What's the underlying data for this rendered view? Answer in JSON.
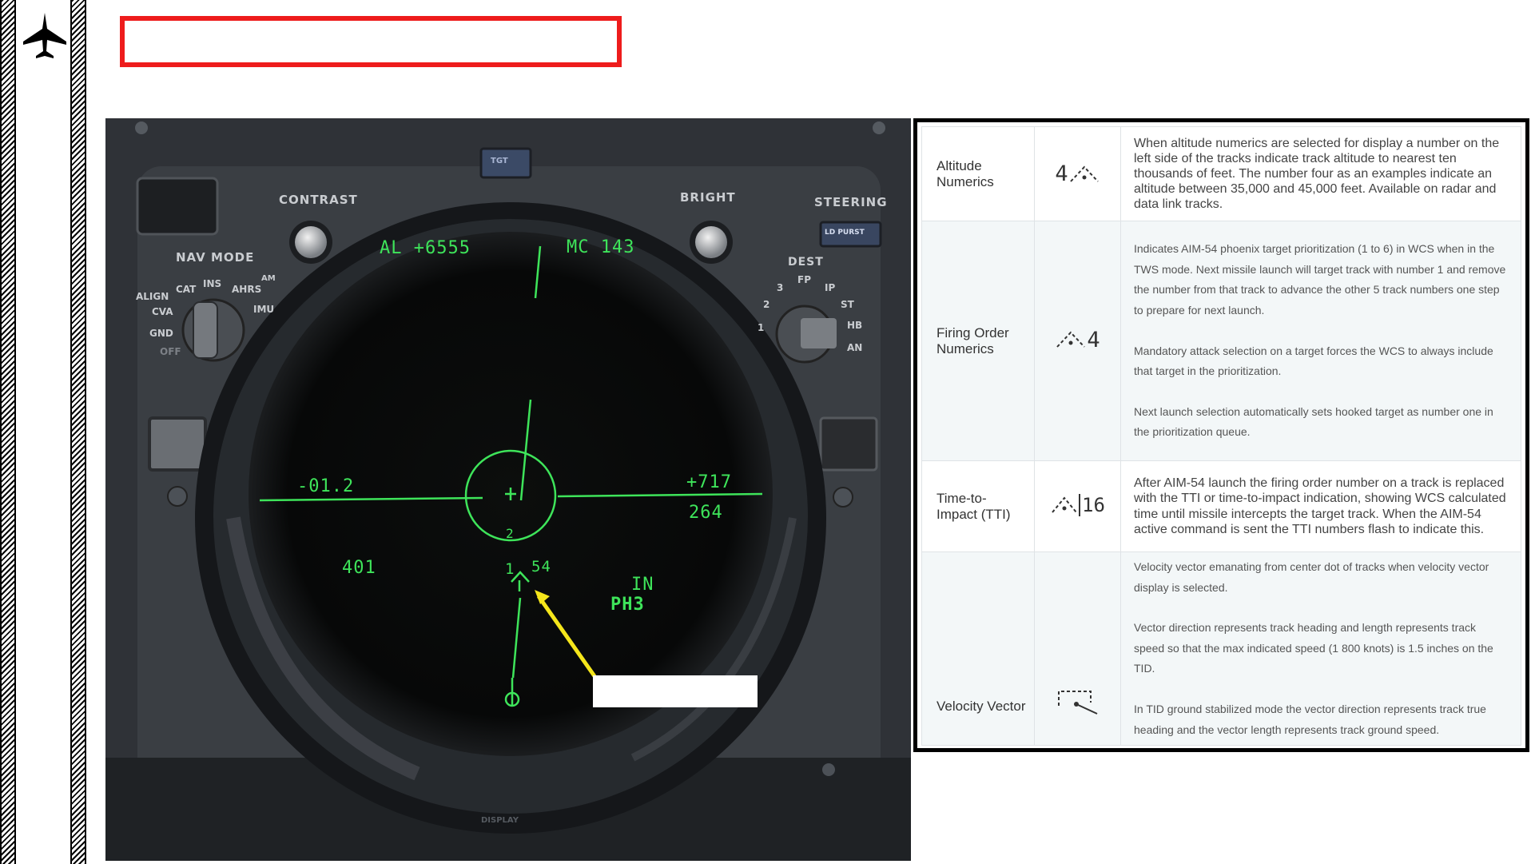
{
  "cockpit": {
    "labels": {
      "contrast": "CONTRAST",
      "bright": "BRIGHT",
      "steering": "STEERING",
      "nav_mode": "NAV MODE",
      "dest": "DEST",
      "tgt": "TGT",
      "ld_purst": "LD PURST",
      "display": "DISPLAY"
    },
    "nav_mode_positions": [
      "ALIGN",
      "CVA",
      "GND",
      "OFF",
      "CAT",
      "INS",
      "AHRS",
      "AM",
      "IMU"
    ],
    "dest_positions": [
      "1",
      "2",
      "3",
      "FP",
      "IP",
      "ST",
      "HB",
      "AN"
    ],
    "tid": {
      "altitude": "AL  +6555",
      "magnetic_course": "MC  143",
      "left_value": "-01.2",
      "right_value": "+717",
      "right_sub": "264",
      "left_lower": "401",
      "track_label": "54",
      "track_left": "1",
      "track_low": "2",
      "in_label": "IN",
      "ph_label": "PH3"
    }
  },
  "table": {
    "rows": [
      {
        "name": "Altitude Numerics",
        "symbol_icon": "altitude-numerics-symbol",
        "symbol_text": "4",
        "description": [
          "When altitude numerics are selected for display a number on the left side of the tracks indicate track altitude to nearest ten thousands of feet. The number four as an examples indicate an altitude between 35,000 and 45,000 feet. Available on radar and data link tracks."
        ]
      },
      {
        "name": "Firing Order Numerics",
        "symbol_icon": "firing-order-numerics-symbol",
        "symbol_text": "4",
        "description": [
          "Indicates AIM-54 phoenix target prioritization (1 to 6) in WCS when in the TWS mode. Next missile launch will target track with number 1 and remove the number from that track to advance the other 5 track numbers one step to prepare for next launch.",
          "Mandatory attack selection on a target forces the WCS to always include that target in the prioritization.",
          "Next launch selection automatically sets hooked target as number one in the prioritization queue."
        ]
      },
      {
        "name": "Time-to-Impact (TTI)",
        "symbol_icon": "time-to-impact-symbol",
        "symbol_text": "16",
        "description": [
          "After AIM-54 launch the firing order number on a track is replaced with the TTI or time-to-impact indication, showing WCS calculated time until missile intercepts the target track. When the AIM-54 active command is sent the TTI numbers flash to indicate this."
        ]
      },
      {
        "name": "Velocity Vector",
        "symbol_icon": "velocity-vector-symbol",
        "symbol_text": "",
        "description": [
          "Velocity vector emanating from center dot of tracks when velocity vector display is selected.",
          "Vector direction represents track heading and length represents track speed so that the max indicated speed (1 800 knots) is 1.5 inches on the TID.",
          "In TID ground stabilized mode the vector direction represents track true heading and the vector length represents track ground speed."
        ]
      }
    ]
  }
}
